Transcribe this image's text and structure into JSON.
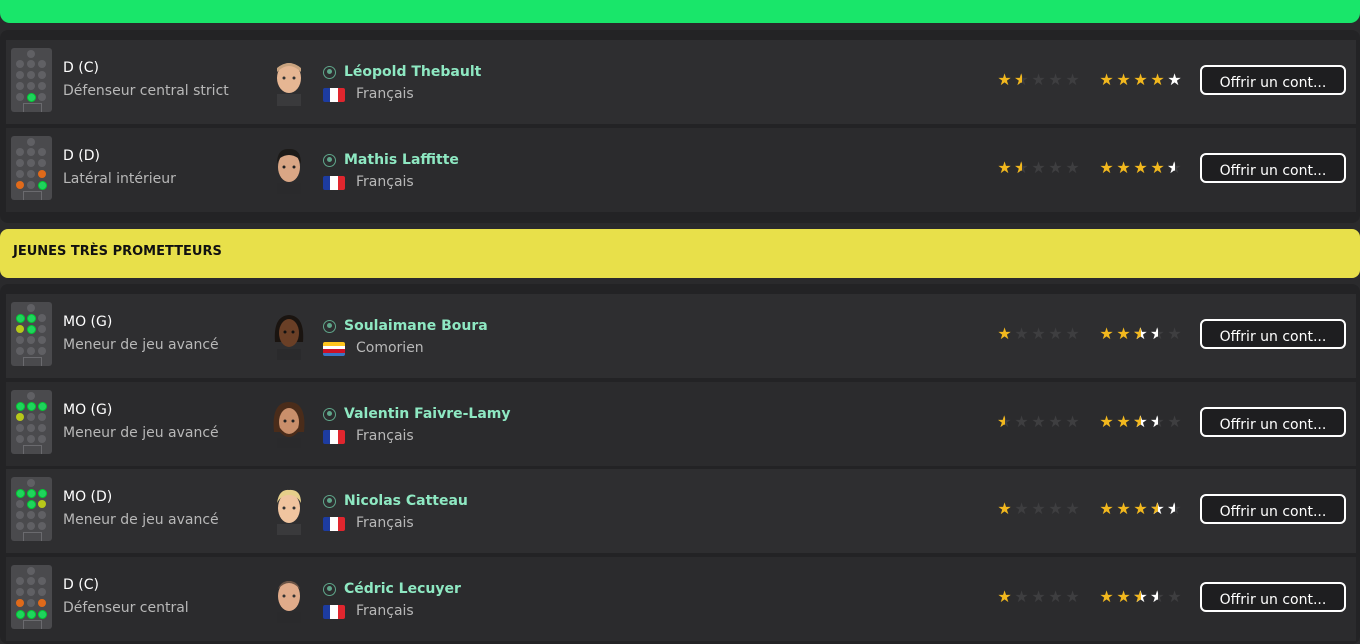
{
  "section_title": "JEUNES TRÈS PROMETTEURS",
  "offer_label": "Offrir un cont...",
  "colors": {
    "accent_green": "#19e66a",
    "banner_yellow": "#e8e04a",
    "name": "#8ee8c2",
    "star": "#f2b81e"
  },
  "group1": [
    {
      "position": "D (C)",
      "role": "Défenseur central strict",
      "name": "Léopold Thebault",
      "nationality": "Français",
      "flag": "fr",
      "current_ability": 1.5,
      "potential_ability": 5,
      "potential_last_white": true
    },
    {
      "position": "D (D)",
      "role": "Latéral intérieur",
      "name": "Mathis Laffitte",
      "nationality": "Français",
      "flag": "fr",
      "current_ability": 1.5,
      "potential_ability": 4.5
    }
  ],
  "group2": [
    {
      "position": "MO (G)",
      "role": "Meneur de jeu avancé",
      "name": "Soulaimane Boura",
      "nationality": "Comorien",
      "flag": "km",
      "current_ability": 1,
      "potential_ability": 3.5
    },
    {
      "position": "MO (G)",
      "role": "Meneur de jeu avancé",
      "name": "Valentin Faivre-Lamy",
      "nationality": "Français",
      "flag": "fr",
      "current_ability": 0.5,
      "potential_ability": 3.5
    },
    {
      "position": "MO (D)",
      "role": "Meneur de jeu avancé",
      "name": "Nicolas Catteau",
      "nationality": "Français",
      "flag": "fr",
      "current_ability": 1,
      "potential_ability": 4.5
    },
    {
      "position": "D (C)",
      "role": "Défenseur central",
      "name": "Cédric Lecuyer",
      "nationality": "Français",
      "flag": "fr",
      "current_ability": 1,
      "potential_ability": 3.5
    }
  ]
}
